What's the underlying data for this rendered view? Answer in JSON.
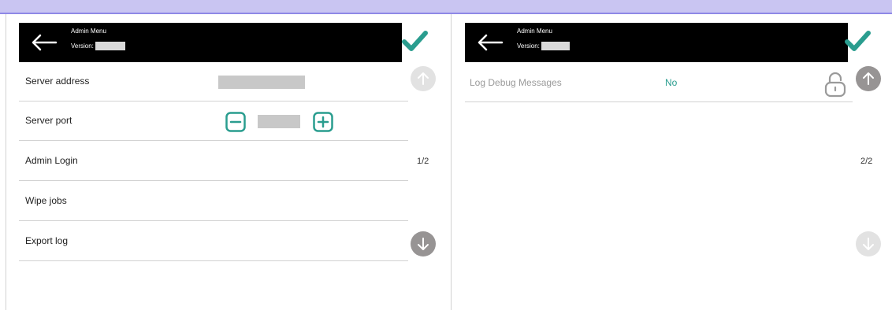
{
  "left_panel": {
    "header": {
      "title": "Admin Menu",
      "version_label": "Version:"
    },
    "rows": [
      {
        "label": "Server address"
      },
      {
        "label": "Server port"
      },
      {
        "label": "Admin Login"
      },
      {
        "label": "Wipe jobs"
      },
      {
        "label": "Export log"
      }
    ],
    "page_indicator": "1/2"
  },
  "right_panel": {
    "header": {
      "title": "Admin Menu",
      "version_label": "Version:"
    },
    "rows": [
      {
        "label": "Log Debug Messages",
        "value": "No"
      }
    ],
    "page_indicator": "2/2"
  },
  "icons": {
    "back": "arrow-left-icon",
    "confirm": "checkmark-icon",
    "scroll_up": "arrow-up-icon",
    "scroll_down": "arrow-down-icon",
    "minus": "minus-icon",
    "plus": "plus-icon",
    "lock": "lock-icon"
  },
  "colors": {
    "accent": "#2a9d8f",
    "header_bg": "#000000",
    "top_strip": "#c9c5f2",
    "value_text": "#2a9d8f"
  }
}
